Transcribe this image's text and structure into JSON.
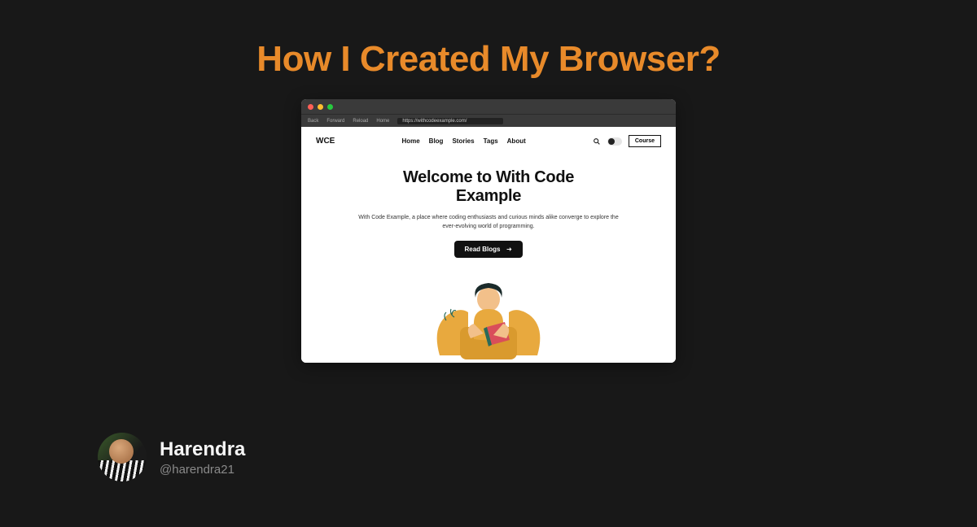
{
  "title": "How I Created My Browser?",
  "browser": {
    "toolbar": {
      "back": "Back",
      "forward": "Forward",
      "reload": "Reload",
      "home": "Home",
      "url": "https://withcodeexample.com/"
    },
    "site": {
      "logo": "WCE",
      "nav": [
        "Home",
        "Blog",
        "Stories",
        "Tags",
        "About"
      ],
      "course_button": "Course",
      "hero_title_line1": "Welcome to With Code",
      "hero_title_line2": "Example",
      "hero_subtitle": "With Code Example, a place where coding enthusiasts and curious minds alike converge to explore the ever-evolving world of programming.",
      "cta": "Read Blogs"
    }
  },
  "author": {
    "name": "Harendra",
    "handle": "@harendra21"
  }
}
